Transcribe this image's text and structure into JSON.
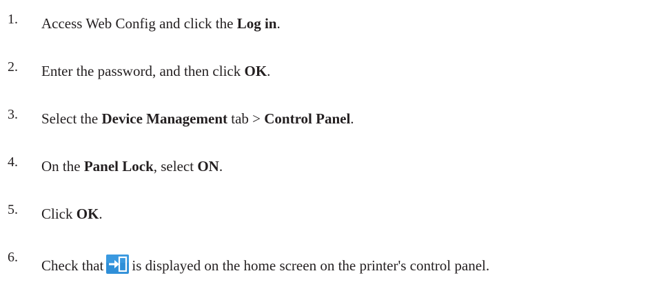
{
  "steps": [
    {
      "num": "1.",
      "parts": [
        {
          "t": "Access Web Config and click the "
        },
        {
          "t": "Log in",
          "b": true
        },
        {
          "t": "."
        }
      ]
    },
    {
      "num": "2.",
      "parts": [
        {
          "t": "Enter the password, and then click "
        },
        {
          "t": "OK",
          "b": true
        },
        {
          "t": "."
        }
      ]
    },
    {
      "num": "3.",
      "parts": [
        {
          "t": "Select the "
        },
        {
          "t": "Device Management",
          "b": true
        },
        {
          "t": " tab > "
        },
        {
          "t": "Control Panel",
          "b": true
        },
        {
          "t": "."
        }
      ]
    },
    {
      "num": "4.",
      "parts": [
        {
          "t": "On the "
        },
        {
          "t": "Panel Lock",
          "b": true
        },
        {
          "t": ", select "
        },
        {
          "t": "ON",
          "b": true
        },
        {
          "t": "."
        }
      ]
    },
    {
      "num": "5.",
      "parts": [
        {
          "t": "Click "
        },
        {
          "t": "OK",
          "b": true
        },
        {
          "t": "."
        }
      ]
    },
    {
      "num": "6.",
      "parts": [
        {
          "t": "Check that"
        },
        {
          "icon": "panel-lock-icon"
        },
        {
          "t": "is displayed on the home screen on the printer's control panel."
        }
      ]
    }
  ],
  "colors": {
    "text": "#231f20",
    "icon_bg": "#2f8fd8",
    "icon_fg": "#ffffff"
  }
}
